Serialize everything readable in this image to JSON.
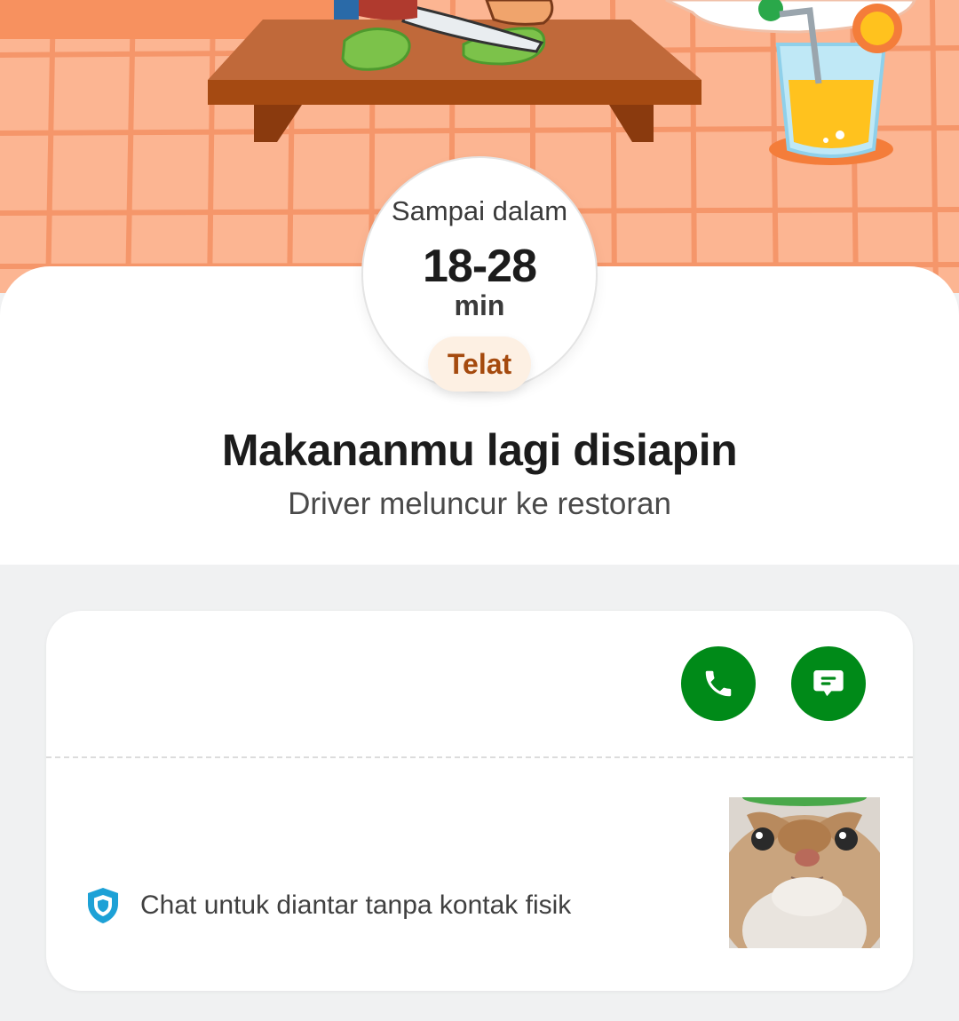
{
  "eta": {
    "label": "Sampai dalam",
    "range": "18-28",
    "unit": "min",
    "badge": "Telat"
  },
  "status": {
    "title": "Makananmu lagi disiapin",
    "subtitle": "Driver meluncur ke restoran"
  },
  "driver_card": {
    "call_icon": "phone-icon",
    "chat_icon": "chat-bubble-icon",
    "safety_icon": "shield-icon",
    "safety_text": "Chat untuk diantar tanpa kontak fisik"
  },
  "colors": {
    "hero_background": "#fcb592",
    "accent_green": "#008a18",
    "badge_text": "#a54a0e",
    "badge_background": "#fdf0e3",
    "shield_blue": "#1da1d6"
  }
}
